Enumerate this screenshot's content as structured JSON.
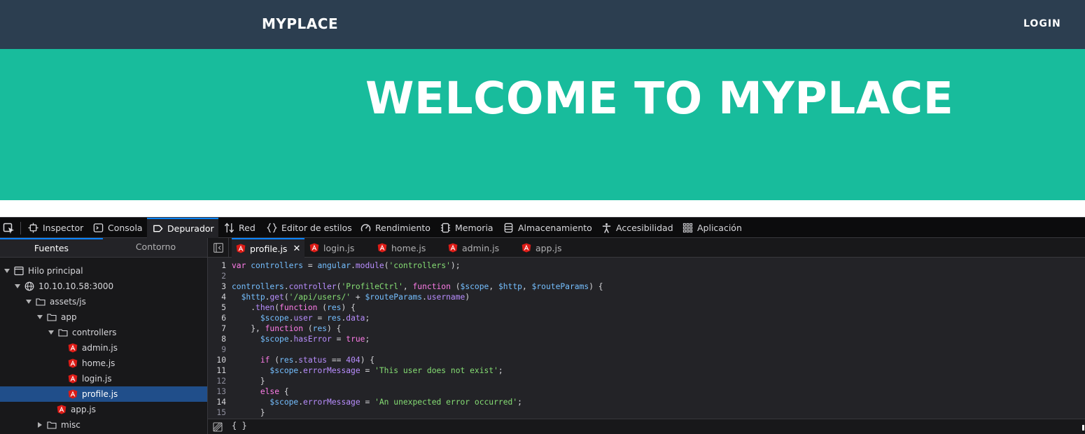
{
  "site": {
    "brand": "MYPLACE",
    "login": "LOGIN",
    "hero_title": "WELCOME TO MYPLACE",
    "colors": {
      "nav": "#2c3e50",
      "hero": "#18bc9c"
    }
  },
  "devtools": {
    "tabs": [
      {
        "label": "Inspector",
        "icon": "inspector-icon"
      },
      {
        "label": "Consola",
        "icon": "console-icon"
      },
      {
        "label": "Depurador",
        "icon": "debugger-icon",
        "active": true
      },
      {
        "label": "Red",
        "icon": "network-icon"
      },
      {
        "label": "Editor de estilos",
        "icon": "style-editor-icon"
      },
      {
        "label": "Rendimiento",
        "icon": "performance-icon"
      },
      {
        "label": "Memoria",
        "icon": "memory-icon"
      },
      {
        "label": "Almacenamiento",
        "icon": "storage-icon"
      },
      {
        "label": "Accesibilidad",
        "icon": "accessibility-icon"
      },
      {
        "label": "Aplicación",
        "icon": "application-icon"
      }
    ],
    "sidebar": {
      "tabs": [
        "Fuentes",
        "Contorno"
      ],
      "tree": [
        {
          "label": "Hilo principal",
          "icon": "window-icon",
          "expanded": true
        },
        {
          "label": "10.10.10.58:3000",
          "icon": "globe-icon",
          "expanded": true
        },
        {
          "label": "assets/js",
          "icon": "folder-icon",
          "expanded": true
        },
        {
          "label": "app",
          "icon": "folder-icon",
          "expanded": true
        },
        {
          "label": "controllers",
          "icon": "folder-icon",
          "expanded": true
        },
        {
          "label": "admin.js",
          "icon": "angular-file-icon"
        },
        {
          "label": "home.js",
          "icon": "angular-file-icon"
        },
        {
          "label": "login.js",
          "icon": "angular-file-icon"
        },
        {
          "label": "profile.js",
          "icon": "angular-file-icon",
          "selected": true
        },
        {
          "label": "app.js",
          "icon": "angular-file-icon"
        },
        {
          "label": "misc",
          "icon": "folder-icon",
          "expanded": false
        }
      ]
    },
    "file_tabs": [
      {
        "label": "profile.js",
        "active": true,
        "close": "✕"
      },
      {
        "label": "login.js"
      },
      {
        "label": "home.js"
      },
      {
        "label": "admin.js"
      },
      {
        "label": "app.js"
      }
    ],
    "code": [
      {
        "n": "1",
        "tokens": [
          [
            "kw",
            "var "
          ],
          [
            "vr",
            "controllers"
          ],
          [
            "tok-plain",
            " = "
          ],
          [
            "vr",
            "angular"
          ],
          [
            "tok-plain",
            "."
          ],
          [
            "pr",
            "module"
          ],
          [
            "tok-plain",
            "("
          ],
          [
            "str",
            "'controllers'"
          ],
          [
            "tok-plain",
            ");"
          ]
        ]
      },
      {
        "n": "2",
        "tokens": []
      },
      {
        "n": "3",
        "tokens": [
          [
            "vr",
            "controllers"
          ],
          [
            "tok-plain",
            "."
          ],
          [
            "pr",
            "controller"
          ],
          [
            "tok-plain",
            "("
          ],
          [
            "str",
            "'ProfileCtrl'"
          ],
          [
            "tok-plain",
            ", "
          ],
          [
            "kw",
            "function"
          ],
          [
            "tok-plain",
            " ("
          ],
          [
            "vr",
            "$scope"
          ],
          [
            "tok-plain",
            ", "
          ],
          [
            "vr",
            "$http"
          ],
          [
            "tok-plain",
            ", "
          ],
          [
            "vr",
            "$routeParams"
          ],
          [
            "tok-plain",
            ") {"
          ]
        ]
      },
      {
        "n": "4",
        "tokens": [
          [
            "tok-plain",
            "  "
          ],
          [
            "vr",
            "$http"
          ],
          [
            "tok-plain",
            "."
          ],
          [
            "pr",
            "get"
          ],
          [
            "tok-plain",
            "("
          ],
          [
            "str",
            "'/api/users/'"
          ],
          [
            "tok-plain",
            " + "
          ],
          [
            "vr",
            "$routeParams"
          ],
          [
            "tok-plain",
            "."
          ],
          [
            "pr",
            "username"
          ],
          [
            "tok-plain",
            ")"
          ]
        ]
      },
      {
        "n": "5",
        "tokens": [
          [
            "tok-plain",
            "    ."
          ],
          [
            "pr",
            "then"
          ],
          [
            "tok-plain",
            "("
          ],
          [
            "kw",
            "function"
          ],
          [
            "tok-plain",
            " ("
          ],
          [
            "vr",
            "res"
          ],
          [
            "tok-plain",
            ") {"
          ]
        ]
      },
      {
        "n": "6",
        "tokens": [
          [
            "tok-plain",
            "      "
          ],
          [
            "vr",
            "$scope"
          ],
          [
            "tok-plain",
            "."
          ],
          [
            "pr",
            "user"
          ],
          [
            "tok-plain",
            " = "
          ],
          [
            "vr",
            "res"
          ],
          [
            "tok-plain",
            "."
          ],
          [
            "pr",
            "data"
          ],
          [
            "tok-plain",
            ";"
          ]
        ]
      },
      {
        "n": "7",
        "tokens": [
          [
            "tok-plain",
            "    }, "
          ],
          [
            "kw",
            "function"
          ],
          [
            "tok-plain",
            " ("
          ],
          [
            "vr",
            "res"
          ],
          [
            "tok-plain",
            ") {"
          ]
        ]
      },
      {
        "n": "8",
        "tokens": [
          [
            "tok-plain",
            "      "
          ],
          [
            "vr",
            "$scope"
          ],
          [
            "tok-plain",
            "."
          ],
          [
            "pr",
            "hasError"
          ],
          [
            "tok-plain",
            " = "
          ],
          [
            "kw",
            "true"
          ],
          [
            "tok-plain",
            ";"
          ]
        ]
      },
      {
        "n": "9",
        "tokens": []
      },
      {
        "n": "10",
        "tokens": [
          [
            "tok-plain",
            "      "
          ],
          [
            "kw",
            "if"
          ],
          [
            "tok-plain",
            " ("
          ],
          [
            "vr",
            "res"
          ],
          [
            "tok-plain",
            "."
          ],
          [
            "pr",
            "status"
          ],
          [
            "tok-plain",
            " == "
          ],
          [
            "pr",
            "404"
          ],
          [
            "tok-plain",
            ") {"
          ]
        ]
      },
      {
        "n": "11",
        "tokens": [
          [
            "tok-plain",
            "        "
          ],
          [
            "vr",
            "$scope"
          ],
          [
            "tok-plain",
            "."
          ],
          [
            "pr",
            "errorMessage"
          ],
          [
            "tok-plain",
            " = "
          ],
          [
            "str",
            "'This user does not exist'"
          ],
          [
            "tok-plain",
            ";"
          ]
        ]
      },
      {
        "n": "12",
        "tokens": [
          [
            "tok-plain",
            "      }"
          ]
        ]
      },
      {
        "n": "13",
        "tokens": [
          [
            "tok-plain",
            "      "
          ],
          [
            "kw",
            "else"
          ],
          [
            "tok-plain",
            " {"
          ]
        ]
      },
      {
        "n": "14",
        "tokens": [
          [
            "tok-plain",
            "        "
          ],
          [
            "vr",
            "$scope"
          ],
          [
            "tok-plain",
            "."
          ],
          [
            "pr",
            "errorMessage"
          ],
          [
            "tok-plain",
            " = "
          ],
          [
            "str",
            "'An unexpected error occurred'"
          ],
          [
            "tok-plain",
            ";"
          ]
        ]
      },
      {
        "n": "15",
        "tokens": [
          [
            "tok-plain",
            "      }"
          ]
        ]
      }
    ],
    "footer": {
      "pretty_print": "{ }"
    }
  }
}
